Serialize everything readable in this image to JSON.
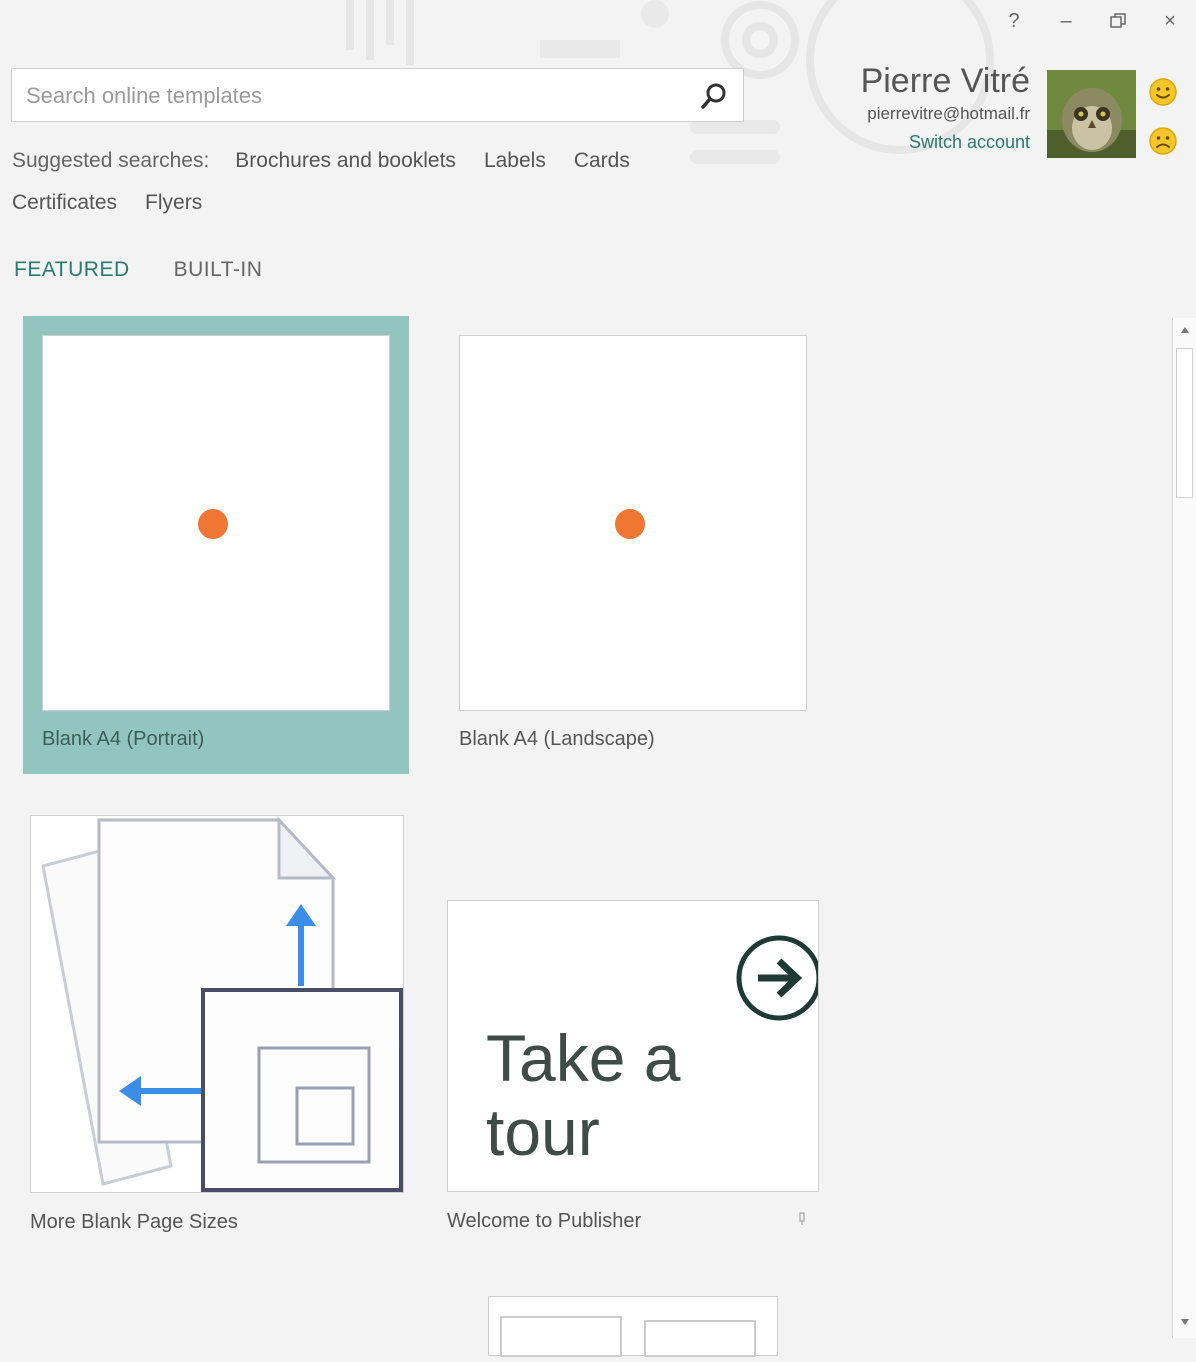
{
  "window": {
    "help": "?",
    "minimize": "–",
    "restore": "⧉",
    "close": "×"
  },
  "search": {
    "placeholder": "Search online templates",
    "value": ""
  },
  "suggested": {
    "label": "Suggested searches:",
    "items": [
      "Brochures and booklets",
      "Labels",
      "Cards",
      "Certificates",
      "Flyers"
    ]
  },
  "account": {
    "name": "Pierre Vitré",
    "email": "pierrevitre@hotmail.fr",
    "switch_label": "Switch account"
  },
  "tabs": [
    {
      "label": "FEATURED",
      "active": true
    },
    {
      "label": "BUILT-IN",
      "active": false
    }
  ],
  "templates": [
    {
      "label": "Blank A4 (Portrait)",
      "selected": true
    },
    {
      "label": "Blank A4 (Landscape)",
      "selected": false
    },
    {
      "label": "More Blank Page Sizes",
      "selected": false
    },
    {
      "label": "Welcome to Publisher",
      "selected": false,
      "tile_text_1": "Take a",
      "tile_text_2": "tour"
    }
  ],
  "colors": {
    "accent": "#2b7a6f",
    "selected_tile": "#92c5c0",
    "dot": "#ef7633",
    "arrow_blue": "#3b8ee8"
  }
}
